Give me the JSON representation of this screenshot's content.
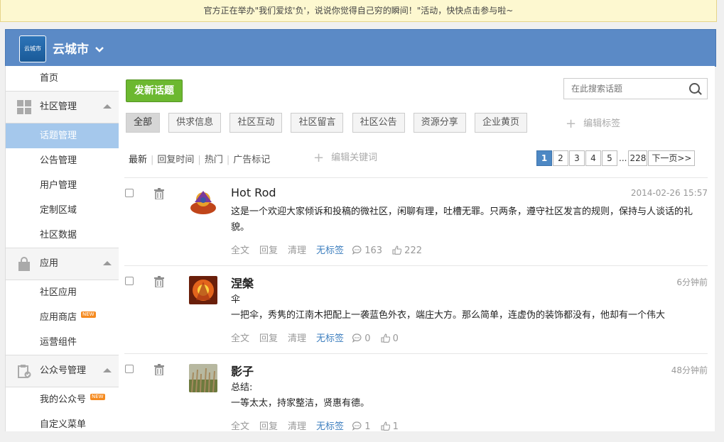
{
  "notice": "官方正在举办\"我们爱炫'负'，说说你觉得自己穷的瞬间！\"活动，快快点击参与啦~",
  "header": {
    "logo_text": "云城市",
    "city": "云城市"
  },
  "sidebar": {
    "home": "首页",
    "groups": [
      {
        "label": "社区管理",
        "items": [
          "话题管理",
          "公告管理",
          "用户管理",
          "定制区域",
          "社区数据"
        ]
      },
      {
        "label": "应用",
        "items": [
          "社区应用",
          "应用商店",
          "运营组件"
        ]
      },
      {
        "label": "公众号管理",
        "items": [
          "我的公众号",
          "自定义菜单"
        ]
      }
    ],
    "new_badge": "NEW"
  },
  "toolbar": {
    "new_topic": "发新话题",
    "search_placeholder": "在此搜索话题"
  },
  "tags": [
    "全部",
    "供求信息",
    "社区互动",
    "社区留言",
    "社区公告",
    "资源分享",
    "企业黄页"
  ],
  "edit_tags": "编辑标签",
  "sort": [
    "最新",
    "回复时间",
    "热门",
    "广告标记"
  ],
  "edit_keywords": "编辑关键词",
  "pager": {
    "pages": [
      "1",
      "2",
      "3",
      "4",
      "5"
    ],
    "dots": "...",
    "last": "228",
    "next": "下一页>>"
  },
  "posts": [
    {
      "name": "Hot Rod",
      "time": "2014-02-26 15:57",
      "body": "这是一个欢迎大家倾诉和投稿的微社区，闲聊有理，吐槽无罪。只两条，遵守社区发言的规则，保持与人谈话的礼貌。",
      "body2": "",
      "comments": "163",
      "likes": "222"
    },
    {
      "name": "涅槃",
      "time": "6分钟前",
      "body": "伞",
      "body2": "一把伞，秀隽的江南木把配上一袭蓝色外衣，端庄大方。那么简单，连虚伪的装饰都没有，他却有一个伟大",
      "comments": "0",
      "likes": "0"
    },
    {
      "name": "影子",
      "time": "48分钟前",
      "body": "总结:",
      "body2": "一等太太，持家整洁，贤惠有德。",
      "comments": "1",
      "likes": "1"
    }
  ],
  "post_actions": {
    "full": "全文",
    "reply": "回复",
    "clean": "清理",
    "no_tag": "无标签"
  }
}
